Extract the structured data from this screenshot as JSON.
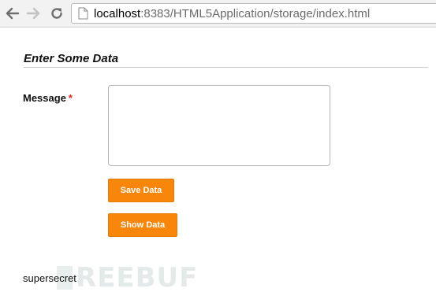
{
  "browser": {
    "url_host": "localhost",
    "url_path": ":8383/HTML5Application/storage/index.html"
  },
  "form": {
    "section_title": "Enter Some Data",
    "message_label": "Message",
    "required_mark": "*",
    "message_value": "",
    "save_button": "Save Data",
    "show_button": "Show Data"
  },
  "output": {
    "text": "supersecret"
  },
  "watermark": {
    "text": "REEBUF"
  },
  "colors": {
    "button_bg": "#f7860a",
    "required": "#e2231a"
  },
  "icons": {
    "back": "back-arrow-icon",
    "forward": "forward-arrow-icon",
    "reload": "reload-icon",
    "page": "page-icon"
  }
}
